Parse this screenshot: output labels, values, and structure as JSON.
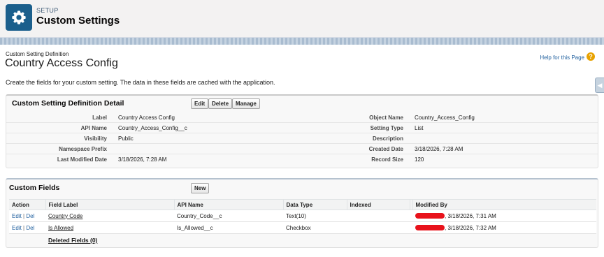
{
  "header": {
    "setup_label": "SETUP",
    "title": "Custom Settings",
    "icon": "gear-icon",
    "icon_bg": "#1b5f8c"
  },
  "page": {
    "breadcrumb": "Custom Setting Definition",
    "title": "Country Access Config",
    "help_link": "Help for this Page",
    "help_icon": "question-icon",
    "description": "Create the fields for your custom setting. The data in these fields are cached with the application."
  },
  "detail": {
    "title": "Custom Setting Definition Detail",
    "buttons": {
      "edit": "Edit",
      "delete": "Delete",
      "manage": "Manage"
    },
    "left": [
      {
        "label": "Label",
        "value": "Country Access Config"
      },
      {
        "label": "API Name",
        "value": "Country_Access_Config__c"
      },
      {
        "label": "Visibility",
        "value": "Public"
      },
      {
        "label": "Namespace Prefix",
        "value": ""
      },
      {
        "label": "Last Modified Date",
        "value": "3/18/2026, 7:28 AM"
      }
    ],
    "right": [
      {
        "label": "Object Name",
        "value": "Country_Access_Config"
      },
      {
        "label": "Setting Type",
        "value": "List"
      },
      {
        "label": "Description",
        "value": ""
      },
      {
        "label": "Created Date",
        "value": "3/18/2026, 7:28 AM"
      },
      {
        "label": "Record Size",
        "value": "120"
      }
    ]
  },
  "fields": {
    "title": "Custom Fields",
    "new_button": "New",
    "columns": {
      "action": "Action",
      "field_label": "Field Label",
      "api_name": "API Name",
      "data_type": "Data Type",
      "indexed": "Indexed",
      "modified_by": "Modified By"
    },
    "rows": [
      {
        "edit": "Edit",
        "sep": "|",
        "del": "Del",
        "field_label": "Country Code",
        "api_name": "Country_Code__c",
        "data_type": "Text(10)",
        "indexed": "",
        "modified": ", 3/18/2026, 7:31 AM"
      },
      {
        "edit": "Edit",
        "sep": "|",
        "del": "Del",
        "field_label": "Is Allowed",
        "api_name": "Is_Allowed__c",
        "data_type": "Checkbox",
        "indexed": "",
        "modified": ", 3/18/2026, 7:32 AM"
      }
    ],
    "deleted_link": "Deleted Fields (0)"
  },
  "colors": {
    "link": "#1f5f9e",
    "redaction": "#e8121b",
    "help_icon": "#e8a200"
  }
}
